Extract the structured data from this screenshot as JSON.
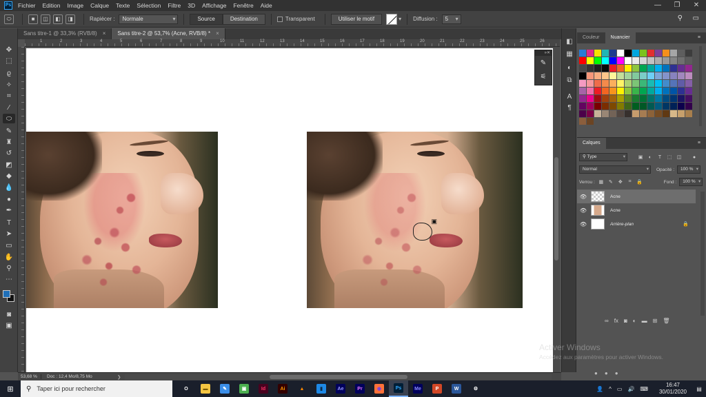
{
  "menu": {
    "logo": "Ps",
    "items": [
      "Fichier",
      "Edition",
      "Image",
      "Calque",
      "Texte",
      "Sélection",
      "Filtre",
      "3D",
      "Affichage",
      "Fenêtre",
      "Aide"
    ],
    "window_controls": [
      "—",
      "❐",
      "✕"
    ]
  },
  "options": {
    "tool_icon": "patch-tool-icon",
    "rapiecer_label": "Rapiécer :",
    "rapiecer_value": "Normale",
    "source_label": "Source",
    "destination_label": "Destination",
    "transparent_label": "Transparent",
    "use_pattern_label": "Utiliser le motif",
    "diffusion_label": "Diffusion :",
    "diffusion_value": "5"
  },
  "tabs": [
    {
      "label": "Sans titre-1 @ 33,3% (RVB/8)",
      "close": "×",
      "active": false
    },
    {
      "label": "Sans titre-2 @ 53,7% (Acne, RVB/8) *",
      "close": "×",
      "active": true
    }
  ],
  "ruler": {
    "marks": [
      "1",
      "2",
      "3",
      "4",
      "5",
      "6",
      "7",
      "8",
      "9",
      "10",
      "11",
      "12",
      "13",
      "14",
      "15",
      "16",
      "17",
      "18",
      "19",
      "20",
      "21",
      "22",
      "23",
      "24",
      "25",
      "26"
    ]
  },
  "tools": [
    {
      "name": "move-icon",
      "glyph": "✥"
    },
    {
      "name": "marquee-icon",
      "glyph": "⬚"
    },
    {
      "name": "lasso-icon",
      "glyph": "ϱ"
    },
    {
      "name": "magic-wand-icon",
      "glyph": "✧"
    },
    {
      "name": "crop-icon",
      "glyph": "⌗"
    },
    {
      "name": "eyedropper-icon",
      "glyph": "⁄"
    },
    {
      "name": "patch-tool-icon",
      "glyph": "⬭"
    },
    {
      "name": "brush-icon",
      "glyph": "✎"
    },
    {
      "name": "clone-stamp-icon",
      "glyph": "♜"
    },
    {
      "name": "history-brush-icon",
      "glyph": "↺"
    },
    {
      "name": "eraser-icon",
      "glyph": "◩"
    },
    {
      "name": "paint-bucket-icon",
      "glyph": "◆"
    },
    {
      "name": "blur-icon",
      "glyph": "💧"
    },
    {
      "name": "dodge-icon",
      "glyph": "●"
    },
    {
      "name": "pen-icon",
      "glyph": "✒"
    },
    {
      "name": "type-icon",
      "glyph": "T"
    },
    {
      "name": "path-select-icon",
      "glyph": "➤"
    },
    {
      "name": "rectangle-icon",
      "glyph": "▭"
    },
    {
      "name": "hand-icon",
      "glyph": "✋"
    },
    {
      "name": "zoom-icon",
      "glyph": "⚲"
    },
    {
      "name": "more-tools-icon",
      "glyph": "⋯"
    }
  ],
  "colors": {
    "foreground": "#1f6fb8",
    "background": "#111111"
  },
  "status": {
    "zoom": "53,68 %",
    "doc": "Doc : 12,4 Mo/8,75 Mo",
    "chevron": "❯"
  },
  "swatch_panel": {
    "tabs": [
      "Couleur",
      "Nuancier"
    ],
    "active": "Nuancier",
    "menu": "≡"
  },
  "swatches": [
    "#2a7bd4",
    "#e02a8a",
    "#f7e200",
    "#20b5b5",
    "#1b3b8f",
    "#ffffff",
    "#000000",
    "#00a6de",
    "#7cc21e",
    "#e22f2f",
    "#7e3f98",
    "#f58f1c",
    "#a6a6a6",
    "#5e5e5e",
    "#3d3d3d",
    "#ff0000",
    "#ffff00",
    "#00ff00",
    "#00ffff",
    "#0000ff",
    "#ff00ff",
    "#ffffff",
    "#ebebeb",
    "#d6d6d6",
    "#c2c2c2",
    "#adadad",
    "#999999",
    "#858585",
    "#707070",
    "#5c5c5c",
    "#474747",
    "#333333",
    "#1f1f1f",
    "#0a0a0a",
    "#ed1c24",
    "#f26522",
    "#fff200",
    "#8dc63f",
    "#00a651",
    "#00a99d",
    "#00aeef",
    "#0072bc",
    "#2e3192",
    "#662d91",
    "#92278f",
    "#000000",
    "#f7977a",
    "#f9ad81",
    "#fdc68a",
    "#fff79a",
    "#c4df9b",
    "#a3d39c",
    "#82ca9d",
    "#7bcdc8",
    "#6ecff6",
    "#7ea7d8",
    "#8493ca",
    "#8882be",
    "#a187be",
    "#bc8dbf",
    "#f49ac2",
    "#f6989d",
    "#ef6c4a",
    "#f58a4b",
    "#fbaf5d",
    "#fff467",
    "#acd372",
    "#7cc576",
    "#3bb878",
    "#1abbb4",
    "#00bff3",
    "#438ccb",
    "#5574b9",
    "#605ca8",
    "#855fa8",
    "#a763a8",
    "#f06ea9",
    "#ed1c24",
    "#f26522",
    "#f7941d",
    "#fff200",
    "#8dc63f",
    "#39b54a",
    "#00a651",
    "#00a99d",
    "#00aeef",
    "#0072bc",
    "#0054a6",
    "#2e3192",
    "#662d91",
    "#92278f",
    "#ec008c",
    "#9e0b0f",
    "#a0410d",
    "#a36209",
    "#aba000",
    "#598527",
    "#1a7b30",
    "#007236",
    "#00746b",
    "#0076a3",
    "#004b80",
    "#003471",
    "#1b1464",
    "#440e62",
    "#630460",
    "#9e005d",
    "#790000",
    "#7b2e00",
    "#7d4900",
    "#827b00",
    "#406618",
    "#005e20",
    "#005826",
    "#005952",
    "#005b7f",
    "#003663",
    "#002157",
    "#0d004c",
    "#32004b",
    "#4b0049",
    "#7b0046",
    "#c7b299",
    "#998675",
    "#736357",
    "#534741",
    "#37302d",
    "#c69c6d",
    "#a67c52",
    "#8c6239",
    "#754c24",
    "#603913",
    "#d7b889",
    "#c7a06c",
    "#a87f4d",
    "#8b5e3c",
    "#6b4423"
  ],
  "layers_panel": {
    "title": "Calques",
    "filter_value": "Type",
    "blend_mode": "Normal",
    "opacity_label": "Opacité :",
    "opacity_value": "100 %",
    "lock_label": "Verrou :",
    "fill_label": "Fond :",
    "fill_value": "100 %",
    "layers": [
      {
        "name": "Acne",
        "selected": true,
        "thumb": "checker",
        "italic": false,
        "lock": ""
      },
      {
        "name": "Acne",
        "selected": false,
        "thumb": "photo",
        "italic": false,
        "lock": ""
      },
      {
        "name": "Arrière-plan",
        "selected": false,
        "thumb": "white",
        "italic": true,
        "lock": "🔒"
      }
    ]
  },
  "watermark": {
    "title": "Activer Windows",
    "sub": "Accédez aux paramètres pour activer Windows."
  },
  "taskbar": {
    "search_placeholder": "Taper ici pour rechercher",
    "apps": [
      {
        "name": "task-view-icon",
        "label": "O",
        "bg": "transparent",
        "fg": "#ffffff"
      },
      {
        "name": "file-explorer-icon",
        "label": "▬",
        "bg": "#f4c542",
        "fg": "#7a5a00"
      },
      {
        "name": "paint-icon",
        "label": "✎",
        "bg": "#3b8ee8",
        "fg": "#ffffff"
      },
      {
        "name": "photos-icon",
        "label": "▣",
        "bg": "#4caf50",
        "fg": "#ffffff"
      },
      {
        "name": "indesign-icon",
        "label": "Id",
        "bg": "#49021f",
        "fg": "#ff3366"
      },
      {
        "name": "illustrator-icon",
        "label": "Ai",
        "bg": "#330000",
        "fg": "#ff9a00"
      },
      {
        "name": "vlc-icon",
        "label": "▲",
        "bg": "transparent",
        "fg": "#ff8800"
      },
      {
        "name": "terminal-icon",
        "label": "▮",
        "bg": "#1e88e5",
        "fg": "#0b2b4a"
      },
      {
        "name": "after-effects-icon",
        "label": "Ae",
        "bg": "#00005b",
        "fg": "#9999ff"
      },
      {
        "name": "premiere-icon",
        "label": "Pr",
        "bg": "#00005b",
        "fg": "#ea77ff"
      },
      {
        "name": "firefox-icon",
        "label": "◉",
        "bg": "#ff7139",
        "fg": "#7542e5"
      },
      {
        "name": "photoshop-icon",
        "label": "Ps",
        "bg": "#001e36",
        "fg": "#31a8ff"
      },
      {
        "name": "media-encoder-icon",
        "label": "Me",
        "bg": "#00005b",
        "fg": "#8d8dff"
      },
      {
        "name": "powerpoint-icon",
        "label": "P",
        "bg": "#d24726",
        "fg": "#ffffff"
      },
      {
        "name": "word-icon",
        "label": "W",
        "bg": "#2b579a",
        "fg": "#ffffff"
      },
      {
        "name": "settings-icon",
        "label": "⚙",
        "bg": "transparent",
        "fg": "#ffffff"
      }
    ],
    "time": "16:47",
    "date": "30/01/2020"
  }
}
